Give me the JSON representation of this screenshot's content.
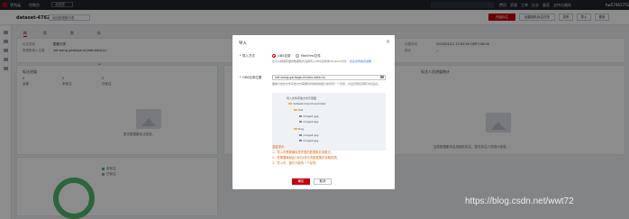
{
  "topbar": {
    "brand": "华为云",
    "console": "控制台",
    "region": "北京四",
    "search_placeholder": "",
    "nav": [
      "费用",
      "资源",
      "工单",
      "企业",
      "备案",
      "支持与服务"
    ],
    "user": "hw57461751"
  },
  "header": {
    "dataset_name": "dataset-4762",
    "switch_label": "返回数据集列表",
    "buttons": [
      "开始标注",
      "创建团队标注任务",
      "发布",
      "导入",
      "更多"
    ]
  },
  "tabs": [
    "概览",
    "版本管理",
    "数据标注",
    "标注任务进展"
  ],
  "info": {
    "fields": [
      {
        "k": "标注类型",
        "v": "图像分类"
      },
      {
        "k": "数据集输入位置",
        "v": "/wt.wang-garbage-ml/obs-data-in/"
      },
      {
        "k": "创建时间",
        "v": "2020/04/21 13:00:59 GMT+08:00"
      },
      {
        "k": "描述",
        "v": "--"
      }
    ]
  },
  "progress": {
    "title": "标注进展",
    "stats": [
      {
        "label": "全部",
        "value": "0"
      },
      {
        "label": "未标注",
        "value": "0"
      },
      {
        "label": "已标注",
        "value": "0"
      }
    ],
    "empty_text": "暂无数据集标注信息。"
  },
  "team_stats": {
    "title": "标注人员进展统计",
    "empty_text": "当前数据集未启用团队标注，暂无标注人员统计信息。"
  },
  "donut_legend": [
    {
      "label": "未标注",
      "color": "#52b66d"
    },
    {
      "label": "已标注",
      "color": "#9aa0a8"
    }
  ],
  "modal": {
    "title": "导入",
    "import_mode_label": "导入方式",
    "options": [
      "OBS目录",
      "Manifest文件"
    ],
    "mode_note": "您可以根据存储的数据格式选择导入OBS目录或Manifest文件。",
    "mode_link": "标注文件格式说明",
    "path_label": "OBS目录位置",
    "path_value": "/wt.wang-garbage-ml/obs-data-in/",
    "path_note": "图像分类的文件存放方式需要将同类别的图片放到同一个目录，并且目录名称即为标签名。",
    "tree_title": "导入文件存放方式示意图",
    "tree": [
      {
        "type": "folder",
        "name": "dataset-import-example"
      },
      {
        "type": "folder",
        "name": "Cat"
      },
      {
        "type": "file",
        "name": "image1.jpg"
      },
      {
        "type": "file",
        "name": "image2.jpg"
      },
      {
        "type": "folder",
        "name": "Dog"
      },
      {
        "type": "file",
        "name": "image1.jpg"
      },
      {
        "type": "file",
        "name": "image2.jpg"
      }
    ],
    "warn_title": "温馨提示：",
    "warn_items": [
      "1、导入时需要确保是完整的数据集目录格式。",
      "2、您需要确保此OBS目录中有数据集的读取权限。",
      "3、导入时，图片只能有一个标签。"
    ],
    "ok": "确定",
    "cancel": "取消"
  },
  "watermark": "https://blog.csdn.net/wwt72"
}
